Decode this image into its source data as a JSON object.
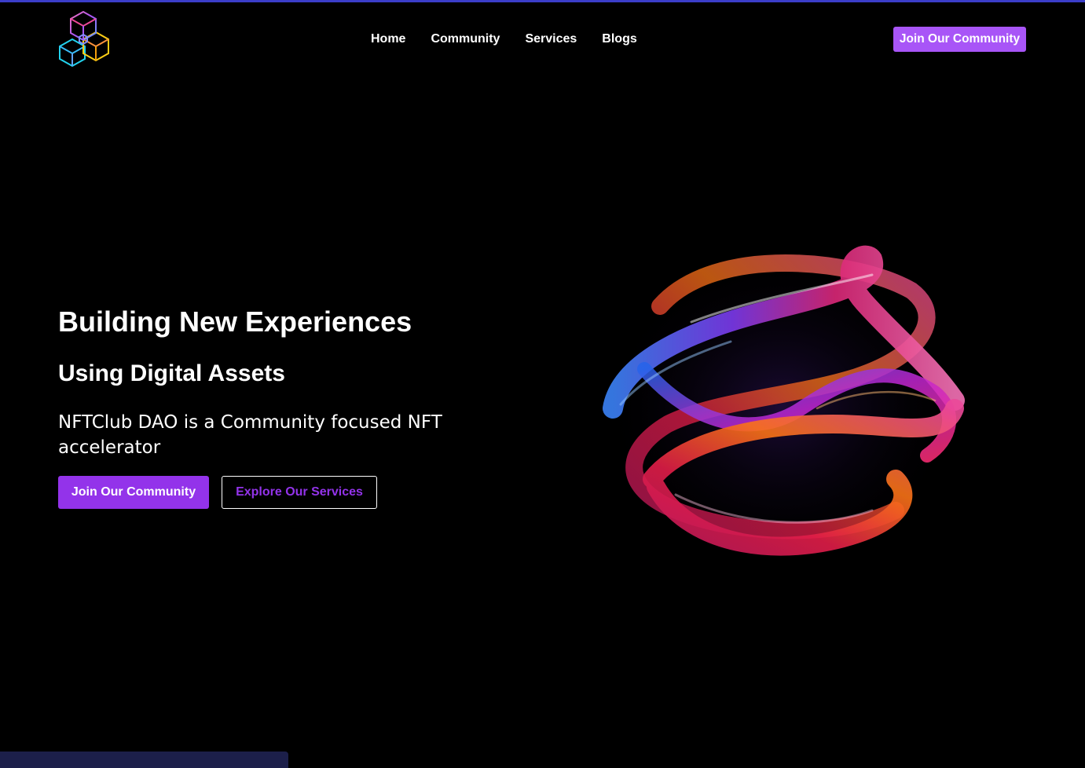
{
  "colors": {
    "background": "#000000",
    "accent": "#9333ea",
    "accent_light": "#a855f7",
    "top_line": "#3b3ec9",
    "bottom_bar": "#1c1f4a"
  },
  "header": {
    "logo_icon": "isometric-cube-logo-icon",
    "nav": [
      "Home",
      "Community",
      "Services",
      "Blogs"
    ],
    "cta_label": "Join Our Community"
  },
  "hero": {
    "title": "Building New Experiences",
    "subtitle": "Using Digital Assets",
    "description": "NFTClub DAO is a Community focused NFT accelerator",
    "primary_button": "Join Our Community",
    "secondary_button": "Explore Our Services",
    "art_icon": "twisted-glass-helix-image"
  }
}
